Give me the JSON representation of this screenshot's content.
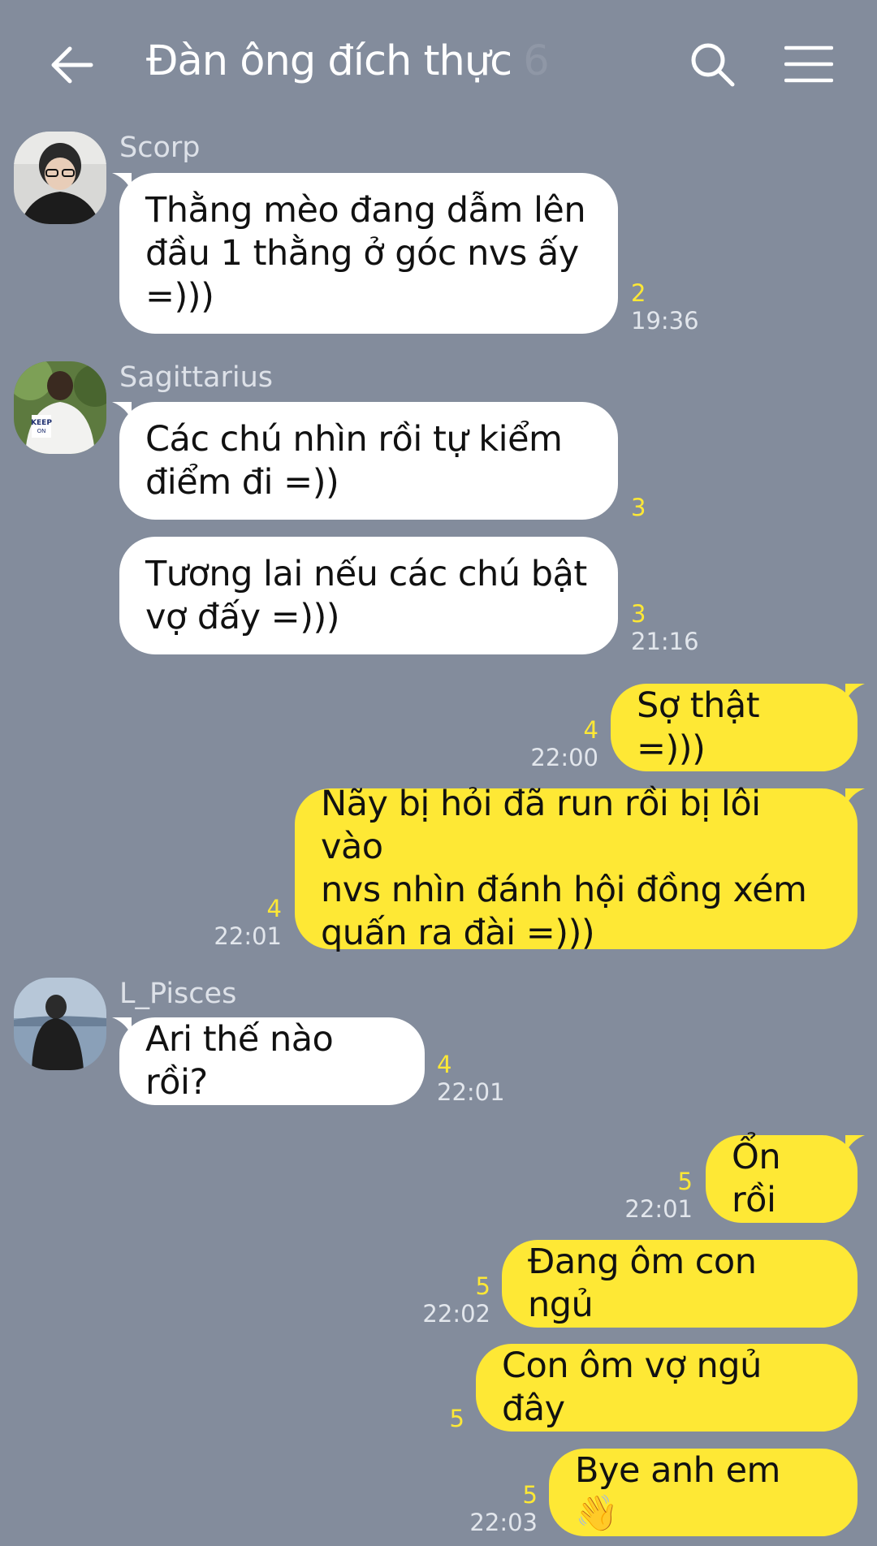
{
  "header": {
    "title": "Đàn ông đích thực",
    "member_count": "6",
    "back_icon": "back-arrow-icon",
    "search_icon": "search-icon",
    "menu_icon": "hamburger-menu-icon"
  },
  "colors": {
    "background": "#838c9c",
    "my_bubble": "#fee835",
    "their_bubble": "#ffffff",
    "unread": "#fee835"
  },
  "messages": [
    {
      "sender": "Scorp",
      "lines": [
        "Thằng mèo đang dẫm lên",
        "đầu 1 thằng ở góc nvs ấy",
        "=)))"
      ],
      "unread": "2",
      "time": "19:36"
    },
    {
      "sender": "Sagittarius",
      "lines": [
        "Các chú nhìn rồi tự kiểm",
        "điểm đi =))"
      ],
      "unread": "3",
      "time": ""
    },
    {
      "sender": "",
      "lines": [
        "Tương lai nếu các chú bật",
        "vợ đấy =)))"
      ],
      "unread": "3",
      "time": "21:16"
    },
    {
      "sender": "me",
      "lines": [
        "Sợ thật =)))"
      ],
      "unread": "4",
      "time": "22:00"
    },
    {
      "sender": "me",
      "lines": [
        "Nãy bị hỏi đã run rồi bị lôi vào",
        "nvs nhìn đánh hội đồng xém",
        "quấn ra đài =)))"
      ],
      "unread": "4",
      "time": "22:01"
    },
    {
      "sender": "L_Pisces",
      "lines": [
        "Ari thế nào rồi?"
      ],
      "unread": "4",
      "time": "22:01"
    },
    {
      "sender": "me",
      "lines": [
        "Ổn rồi"
      ],
      "unread": "5",
      "time": "22:01"
    },
    {
      "sender": "me",
      "lines": [
        "Đang ôm con ngủ"
      ],
      "unread": "5",
      "time": "22:02"
    },
    {
      "sender": "me",
      "lines": [
        "Con ôm vợ ngủ đây"
      ],
      "unread": "5",
      "time": ""
    },
    {
      "sender": "me",
      "lines": [
        "Bye anh em 👋"
      ],
      "unread": "5",
      "time": "22:03"
    }
  ]
}
